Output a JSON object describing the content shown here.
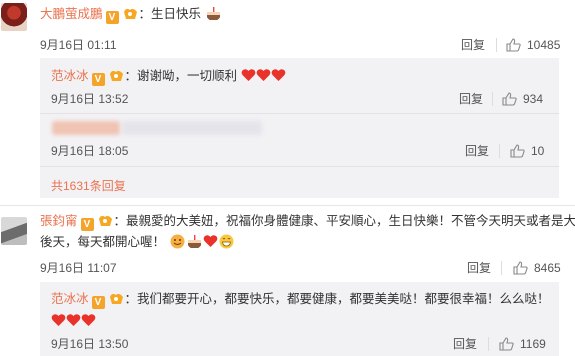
{
  "comments": [
    {
      "name": "大鵬萤成鵬",
      "text": "：生日快乐",
      "time": "9月16日 01:11",
      "reply": "回复",
      "likes": "10485",
      "replies": [
        {
          "name": "范冰冰",
          "text": "：谢谢呦，一切顺利",
          "time": "9月16日 13:52",
          "reply": "回复",
          "likes": "934"
        },
        {
          "time": "9月16日 18:05",
          "reply": "回复",
          "likes": "10"
        }
      ],
      "more": "共1631条回复"
    },
    {
      "name": "張鈞甯",
      "text_line1": "：最親愛的大美妞，祝福你身體健康、平安順心，生日快樂！不管今天明天或者是大",
      "text_line2": "後天，每天都開心喔！",
      "time": "9月16日 11:07",
      "reply": "回复",
      "likes": "8465",
      "replies": [
        {
          "name": "范冰冰",
          "text": "：我们都要开心，都要快乐，都要健康，都要美美哒！都要很幸福！么么哒！",
          "time": "9月16日 13:50",
          "reply": "回复",
          "likes": "1169"
        }
      ]
    }
  ],
  "colors": {
    "name": "#eb7350",
    "sub_bg": "#f2f2f5",
    "heart": "#e8322a",
    "v_badge": "#f4a32b"
  },
  "icons": [
    "thumb-up-icon",
    "heart-icon",
    "cake-icon",
    "v-badge-icon",
    "vip-badge-icon"
  ]
}
